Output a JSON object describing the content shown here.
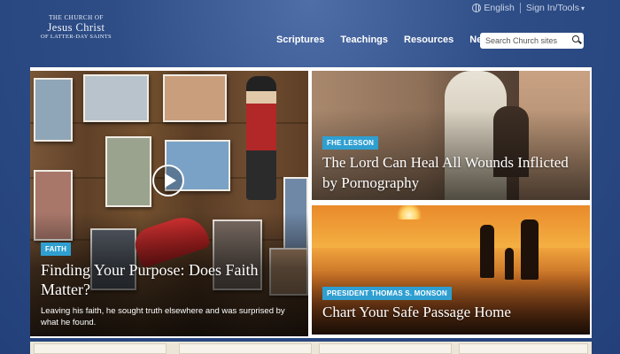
{
  "logo": {
    "line1": "The Church of",
    "line2": "Jesus Christ",
    "line3": "of Latter-day Saints"
  },
  "utility": {
    "language": "English",
    "signin": "Sign In/Tools"
  },
  "nav": {
    "items": [
      "Scriptures",
      "Teachings",
      "Resources",
      "News"
    ]
  },
  "search": {
    "placeholder": "Search Church sites"
  },
  "features": {
    "main": {
      "tag": "FAITH",
      "headline": "Finding Your Purpose: Does Faith Matter?",
      "blurb": "Leaving his faith, he sought truth elsewhere and was surprised by what he found."
    },
    "top_right": {
      "tag": "FHE LESSON",
      "headline": "The Lord Can Heal All Wounds Inflicted by Pornography"
    },
    "bottom_right": {
      "tag": "PRESIDENT THOMAS S. MONSON",
      "headline": "Chart Your Safe Passage Home"
    }
  },
  "colors": {
    "background": "#2e4d86",
    "accent": "#2f9fd1"
  }
}
